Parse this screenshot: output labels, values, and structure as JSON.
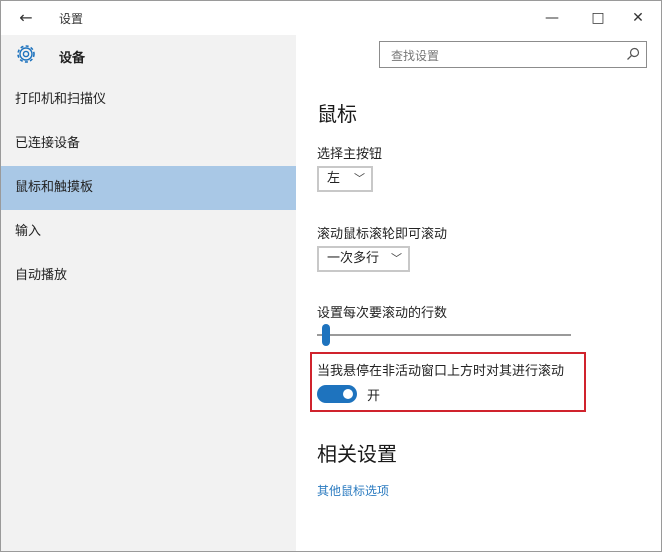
{
  "window": {
    "title": "设置",
    "back_icon": "←",
    "minimize_icon": "—",
    "maximize_icon": "□",
    "close_icon": "✕"
  },
  "header": {
    "title": "设备",
    "icon": "gear-icon"
  },
  "search": {
    "placeholder": "查找设置",
    "icon": "search-icon"
  },
  "sidebar": {
    "items": [
      {
        "label": "打印机和扫描仪",
        "active": false
      },
      {
        "label": "已连接设备",
        "active": false
      },
      {
        "label": "鼠标和触摸板",
        "active": true
      },
      {
        "label": "输入",
        "active": false
      },
      {
        "label": "自动播放",
        "active": false
      }
    ]
  },
  "main": {
    "title": "鼠标",
    "primary_button": {
      "label": "选择主按钮",
      "value": "左"
    },
    "scroll_mode": {
      "label": "滚动鼠标滚轮即可滚动",
      "value": "一次多行"
    },
    "scroll_lines": {
      "label": "设置每次要滚动的行数",
      "value_fraction": 0.02
    },
    "inactive_scroll": {
      "label": "当我悬停在非活动窗口上方时对其进行滚动",
      "state": "开",
      "on": true
    },
    "related": {
      "title": "相关设置",
      "link": "其他鼠标选项"
    }
  },
  "colors": {
    "accent": "#1e73be",
    "sidebar_active": "#a9c8e6",
    "sidebar_bg": "#f2f2f2",
    "highlight_border": "#d0232d",
    "link": "#2b7bc0"
  }
}
